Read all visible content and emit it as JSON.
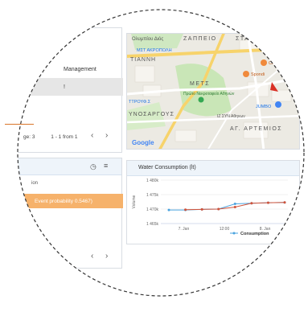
{
  "menu": {
    "items": [
      {
        "label": "Management"
      },
      {
        "label": "!"
      }
    ],
    "pager": {
      "page_text": "ge: 3",
      "range_text": "1 - 1 from 1",
      "prev": "‹",
      "next": "›"
    }
  },
  "map": {
    "labels": [
      {
        "text": "Ολυμπίου Διός"
      },
      {
        "text": "ΖΑΠΠΕΙΟ"
      },
      {
        "text": "ΣΤΑΔ"
      },
      {
        "text": "ΜΣΤ ΑΚΡΟΠΟΛΗ"
      },
      {
        "text": "ΤΙΑΝΝΗ"
      },
      {
        "text": "ΜΕΤΣ"
      },
      {
        "text": "Πρώτο Νεκροταφείο Αθηνών"
      },
      {
        "text": "Colibri"
      },
      {
        "text": "Spondi"
      },
      {
        "text": "ΤΤΡΟΥΦ.Σ"
      },
      {
        "text": "ΥΝΟΣΑΡΓΟΥΣ"
      },
      {
        "text": "IZ ΣΥΝ Αθηνων"
      },
      {
        "text": "JUMBO"
      },
      {
        "text": "ΑΓ. ΑΡΤΕΜΙΟΣ"
      },
      {
        "text": "Google"
      }
    ]
  },
  "events": {
    "column_label": "ion",
    "row_text": "Event probability 0.5467)"
  },
  "chart": {
    "title": "Water Consumption (lt)"
  },
  "chart_data": {
    "type": "line",
    "title": "Water Consumption (lt)",
    "ylabel": "Volume",
    "xlabel": "",
    "x_ticks": [
      "7. Jan",
      "12:00",
      "8. Jan"
    ],
    "y_ticks": [
      "1 480k",
      "1 475k",
      "1 470k",
      "1 465k"
    ],
    "ylim": [
      1465000,
      1480000
    ],
    "x": [
      0,
      1,
      2,
      3,
      4,
      5,
      6,
      7
    ],
    "series": [
      {
        "name": "Consumption",
        "color": "#4aa3df",
        "values": [
          1469700,
          1469700,
          1469900,
          1470000,
          1471800,
          1472000,
          1472200,
          1472300
        ]
      },
      {
        "name": "",
        "color": "#d1533a",
        "values": [
          null,
          1469800,
          1469900,
          1470000,
          1470700,
          1472000,
          1472200,
          1472300
        ]
      }
    ],
    "legend_position": "bottom-right",
    "grid": true
  }
}
